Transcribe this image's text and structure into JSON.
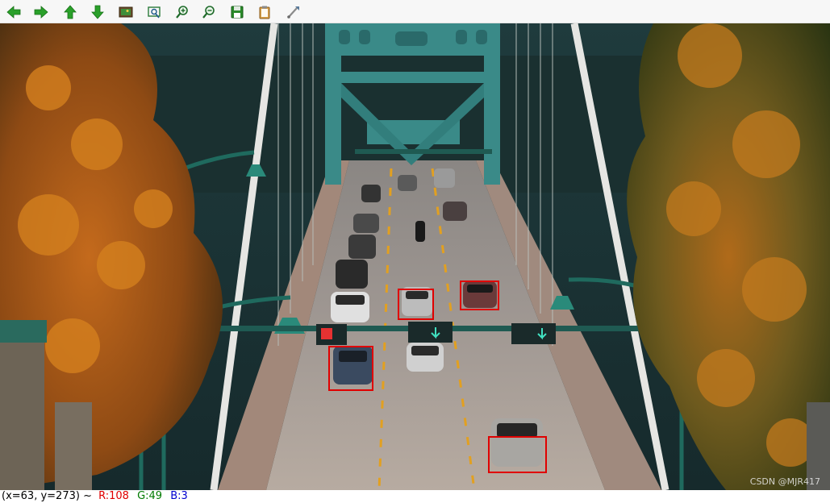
{
  "toolbar": {
    "icons": [
      "arrow-left-icon",
      "arrow-right-icon",
      "arrow-up-icon",
      "arrow-down-icon",
      "image-icon",
      "zoom-window-icon",
      "zoom-in-icon",
      "zoom-out-icon",
      "save-icon",
      "copy-icon",
      "properties-icon"
    ]
  },
  "canvas": {
    "watermark": "CSDN @MJR417",
    "box_color": "#e00000",
    "detections": [
      "car",
      "car",
      "car",
      "car"
    ]
  },
  "status": {
    "coords": "(x=63, y=273) ~",
    "r": "R:108",
    "g": "G:49",
    "b": "B:3"
  },
  "colors": {
    "toolbar_green": "#2aa02a",
    "r_color": "#e00000",
    "g_color": "#007a00",
    "b_color": "#0000d0"
  }
}
